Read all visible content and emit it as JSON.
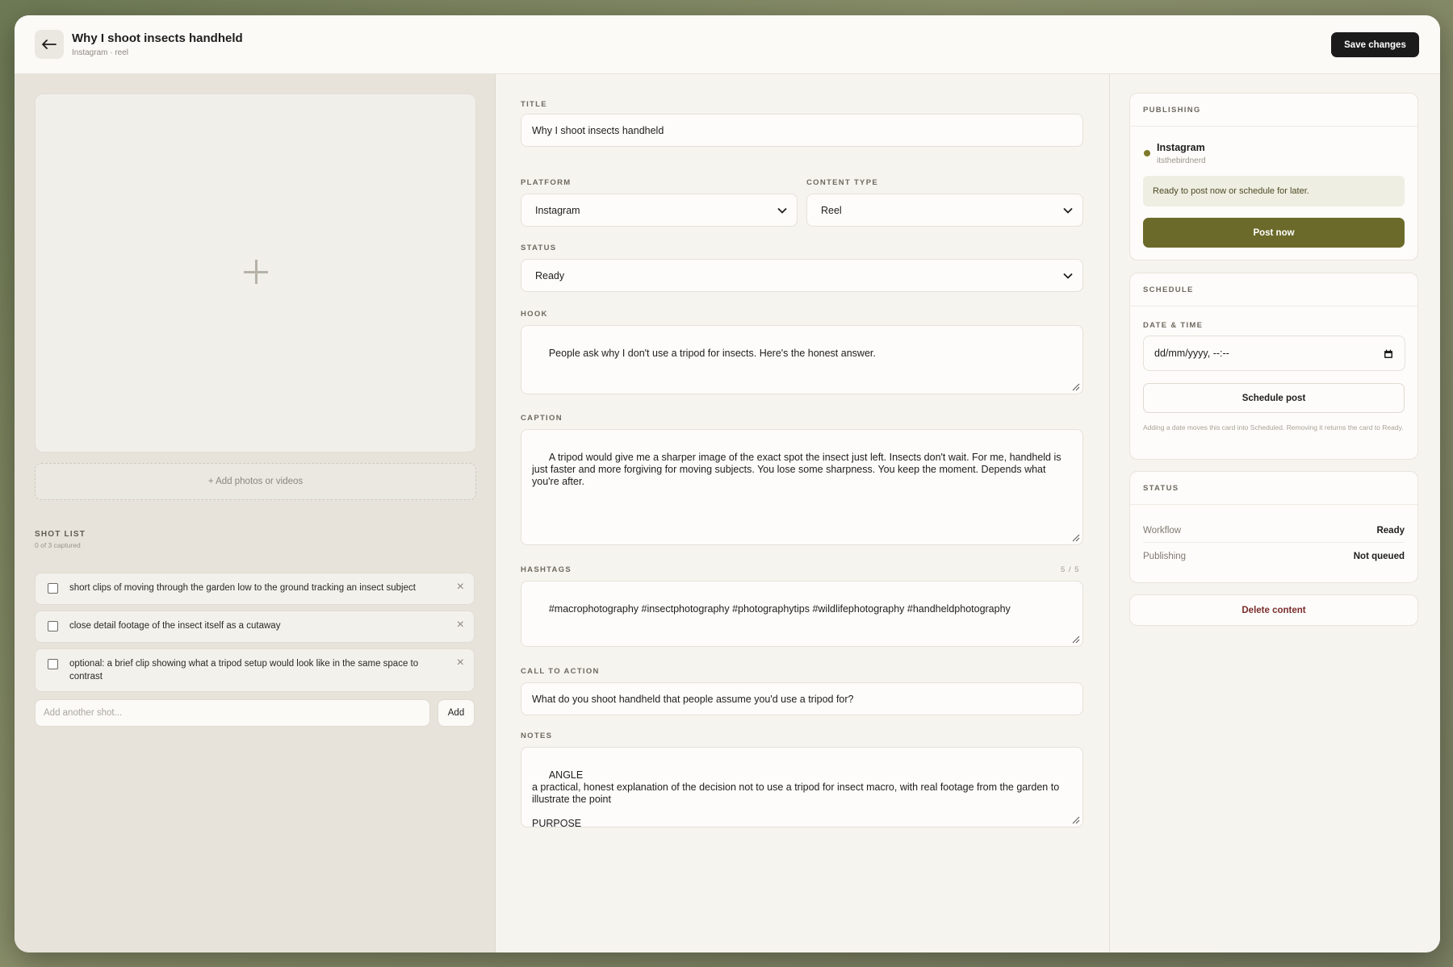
{
  "header": {
    "title": "Why I shoot insects handheld",
    "subtitle": "Instagram · reel",
    "save_label": "Save changes"
  },
  "media": {
    "add_label": "+ Add photos or videos"
  },
  "shot_list": {
    "heading": "SHOT LIST",
    "count": "0 of 3 captured",
    "items": [
      {
        "text": "short clips of moving through the garden low to the ground tracking an insect subject",
        "checked": false
      },
      {
        "text": "close detail footage of the insect itself as a cutaway",
        "checked": false
      },
      {
        "text": "optional: a brief clip showing what a tripod setup would look like in the same space to contrast",
        "checked": false
      }
    ],
    "add_placeholder": "Add another shot...",
    "add_button": "Add"
  },
  "form": {
    "title_label": "TITLE",
    "title_value": "Why I shoot insects handheld",
    "platform_label": "PLATFORM",
    "platform_value": "Instagram",
    "content_type_label": "CONTENT TYPE",
    "content_type_value": "Reel",
    "status_label": "STATUS",
    "status_value": "Ready",
    "hook_label": "HOOK",
    "hook_value": "People ask why I don't use a tripod for insects. Here's the honest answer.",
    "caption_label": "CAPTION",
    "caption_value": "A tripod would give me a sharper image of the exact spot the insect just left. Insects don't wait. For me, handheld is just faster and more forgiving for moving subjects. You lose some sharpness. You keep the moment. Depends what you're after.",
    "hashtags_label": "HASHTAGS",
    "hashtags_count": "5 / 5",
    "hashtags_value": "#macrophotography #insectphotography #photographytips #wildlifephotography #handheldphotography",
    "cta_label": "CALL TO ACTION",
    "cta_value": "What do you shoot handheld that people assume you'd use a tripod for?",
    "notes_label": "NOTES",
    "notes_value": "ANGLE\na practical, honest explanation of the decision not to use a tripod for insect macro, with real footage from the garden to illustrate the point\n\nPURPOSE\nanswers a question photographers genuinely ask, positions Gemma as someone with considered opinions rather"
  },
  "publishing": {
    "title": "PUBLISHING",
    "account_name": "Instagram",
    "account_handle": "itsthebirdnerd",
    "status_message": "Ready to post now or schedule for later.",
    "post_button": "Post now",
    "accent_color": "#6b6a2a"
  },
  "schedule": {
    "title": "SCHEDULE",
    "date_label": "DATE & TIME",
    "date_placeholder": "dd/mm/yyyy, --:--",
    "schedule_button": "Schedule post",
    "hint": "Adding a date moves this card into Scheduled. Removing it returns the card to Ready."
  },
  "status_card": {
    "title": "STATUS",
    "rows": [
      {
        "label": "Workflow",
        "value": "Ready"
      },
      {
        "label": "Publishing",
        "value": "Not queued"
      }
    ]
  },
  "delete_button": "Delete content"
}
